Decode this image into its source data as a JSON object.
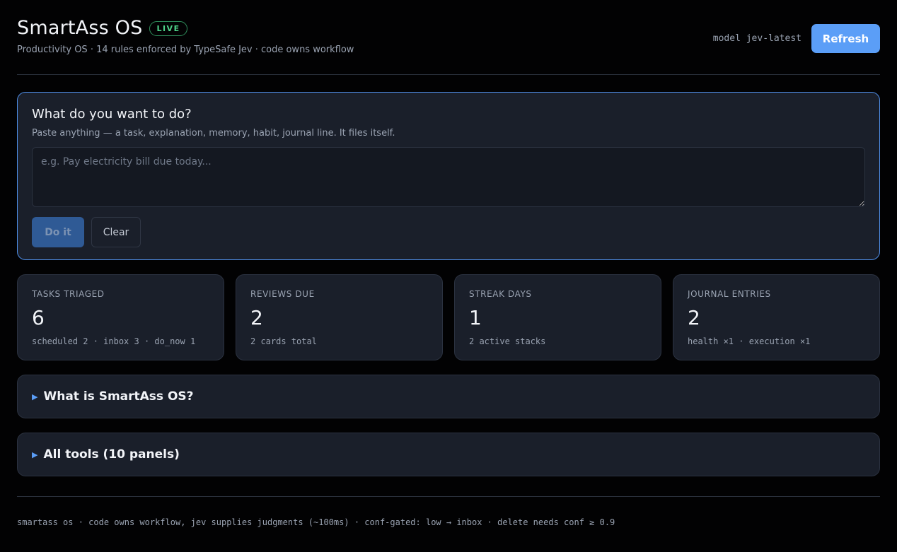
{
  "header": {
    "title": "SmartAss OS",
    "badge": "LIVE",
    "subtitle": "Productivity OS · 14 rules enforced by TypeSafe Jev · code owns workflow",
    "model_label": "model jev-latest",
    "refresh_label": "Refresh"
  },
  "compose": {
    "title": "What do you want to do?",
    "hint": "Paste anything — a task, explanation, memory, habit, journal line. It files itself.",
    "placeholder": "e.g. Pay electricity bill due today...",
    "value": "",
    "do_label": "Do it",
    "clear_label": "Clear"
  },
  "stats": [
    {
      "label": "TASKS TRIAGED",
      "value": "6",
      "detail": "scheduled 2 · inbox 3 · do_now 1"
    },
    {
      "label": "REVIEWS DUE",
      "value": "2",
      "detail": "2 cards total"
    },
    {
      "label": "STREAK DAYS",
      "value": "1",
      "detail": "2 active stacks"
    },
    {
      "label": "JOURNAL ENTRIES",
      "value": "2",
      "detail": "health ×1 · execution ×1"
    }
  ],
  "sections": [
    {
      "label": "What is SmartAss OS?"
    },
    {
      "label": "All tools (10 panels)"
    }
  ],
  "footer": {
    "text": "smartass os · code owns workflow, jev supplies judgments (~100ms) · conf-gated: low → inbox · delete needs conf ≥ 0.9"
  },
  "colors": {
    "accent": "#5b9ef7",
    "live": "#4fd38a",
    "card_bg": "#1a1f2a",
    "page_bg": "#020203"
  },
  "icons": {
    "section_toggle": "caret-right-icon"
  }
}
